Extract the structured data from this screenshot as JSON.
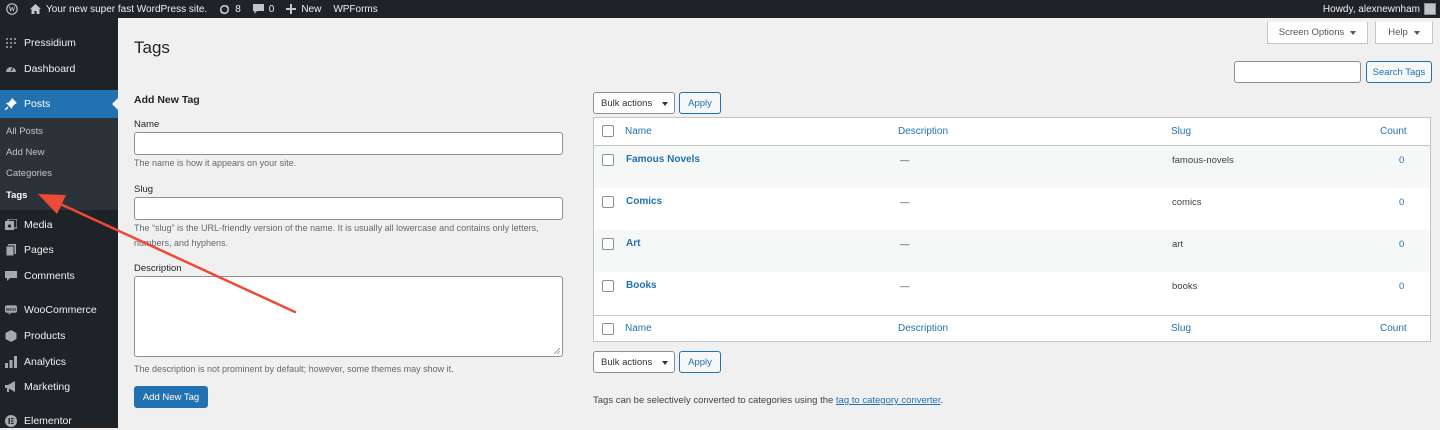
{
  "adminbar": {
    "site_name": "Your new super fast WordPress site.",
    "updates_count": "8",
    "comments_count": "0",
    "new_label": "New",
    "wpforms_label": "WPForms",
    "howdy": "Howdy, alexnewnham"
  },
  "sidebar": {
    "items": [
      {
        "label": "Pressidium",
        "icon": "pressidium-icon"
      },
      {
        "label": "Dashboard",
        "icon": "dashboard-icon"
      },
      {
        "label": "Posts",
        "icon": "pin-icon"
      },
      {
        "label": "Media",
        "icon": "media-icon"
      },
      {
        "label": "Pages",
        "icon": "pages-icon"
      },
      {
        "label": "Comments",
        "icon": "comments-icon"
      },
      {
        "label": "WooCommerce",
        "icon": "woocommerce-icon"
      },
      {
        "label": "Products",
        "icon": "products-icon"
      },
      {
        "label": "Analytics",
        "icon": "analytics-icon"
      },
      {
        "label": "Marketing",
        "icon": "megaphone-icon"
      },
      {
        "label": "Elementor",
        "icon": "elementor-icon"
      }
    ],
    "submenu": [
      "All Posts",
      "Add New",
      "Categories",
      "Tags"
    ]
  },
  "header": {
    "title": "Tags",
    "screen_options": "Screen Options",
    "help": "Help"
  },
  "search": {
    "button": "Search Tags",
    "value": ""
  },
  "form": {
    "heading": "Add New Tag",
    "name_label": "Name",
    "name_help": "The name is how it appears on your site.",
    "slug_label": "Slug",
    "slug_help": "The “slug” is the URL-friendly version of the name. It is usually all lowercase and contains only letters, numbers, and hyphens.",
    "description_label": "Description",
    "description_help": "The description is not prominent by default; however, some themes may show it.",
    "submit": "Add New Tag"
  },
  "bulk": {
    "select_label": "Bulk actions",
    "apply": "Apply"
  },
  "table": {
    "columns": [
      "Name",
      "Description",
      "Slug",
      "Count"
    ],
    "rows": [
      {
        "name": "Famous Novels",
        "description": "—",
        "slug": "famous-novels",
        "count": "0"
      },
      {
        "name": "Comics",
        "description": "—",
        "slug": "comics",
        "count": "0"
      },
      {
        "name": "Art",
        "description": "—",
        "slug": "art",
        "count": "0"
      },
      {
        "name": "Books",
        "description": "—",
        "slug": "books",
        "count": "0"
      }
    ]
  },
  "footnote": {
    "text": "Tags can be selectively converted to categories using the ",
    "link": "tag to category converter",
    "suffix": "."
  },
  "colors": {
    "accent": "#2271b1",
    "sidebar_bg": "#1d2327",
    "annotation_arrow": "#ef4a36"
  }
}
